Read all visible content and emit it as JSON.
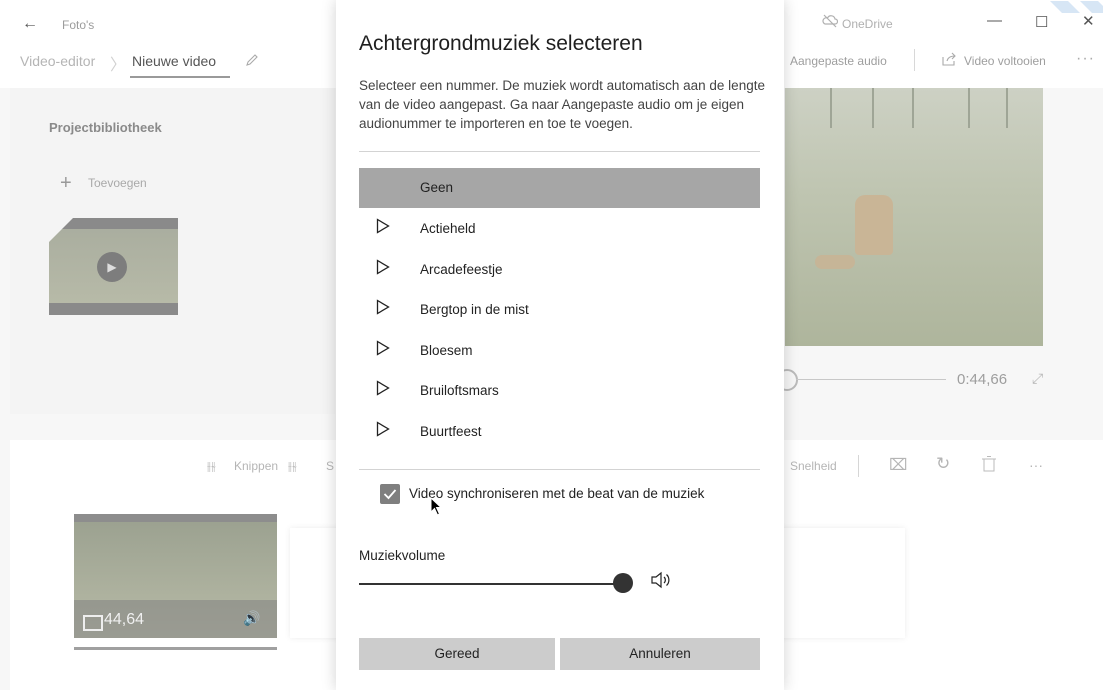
{
  "titlebar": {
    "app_name": "Foto's",
    "onedrive": "OneDrive",
    "minimize_glyph": "—",
    "maximize_glyph": "☐",
    "close_glyph": "✕",
    "back_glyph": "←"
  },
  "nav": {
    "crumb_parent": "Video-editor",
    "crumb_current": "Nieuwe video",
    "custom_audio": "Aangepaste audio",
    "finish_video": "Video voltooien",
    "more": "···"
  },
  "library": {
    "title": "Projectbibliotheek",
    "add_label": "Toevoegen",
    "add_glyph": "+"
  },
  "preview": {
    "time": "0:44,66",
    "expand_glyph": "⤢"
  },
  "toolbar": {
    "cut": "Knippen",
    "split": "S",
    "speed": "Snelheid",
    "more": "···"
  },
  "storyboard": {
    "clip_duration": "44,64",
    "volume_glyph": "🔊"
  },
  "dialog": {
    "title": "Achtergrondmuziek selecteren",
    "description": "Selecteer een nummer. De muziek wordt automatisch aan de lengte van de video aangepast. Ga naar Aangepaste audio om je eigen audionummer te importeren en toe te voegen.",
    "tracks": [
      {
        "label": "Geen",
        "selected": true
      },
      {
        "label": "Actieheld",
        "selected": false
      },
      {
        "label": "Arcadefeestje",
        "selected": false
      },
      {
        "label": "Bergtop in de mist",
        "selected": false
      },
      {
        "label": "Bloesem",
        "selected": false
      },
      {
        "label": "Bruiloftsmars",
        "selected": false
      },
      {
        "label": "Buurtfeest",
        "selected": false
      }
    ],
    "sync_label": "Video synchroniseren met de beat van de muziek",
    "sync_checked": true,
    "volume_label": "Muziekvolume",
    "volume_level": 1.0,
    "ok_button": "Gereed",
    "cancel_button": "Annuleren"
  },
  "colors": {
    "accent_selected": "#a6a6a6",
    "checkbox": "#7f7f7f",
    "dim_text": "#a6a6a6"
  }
}
